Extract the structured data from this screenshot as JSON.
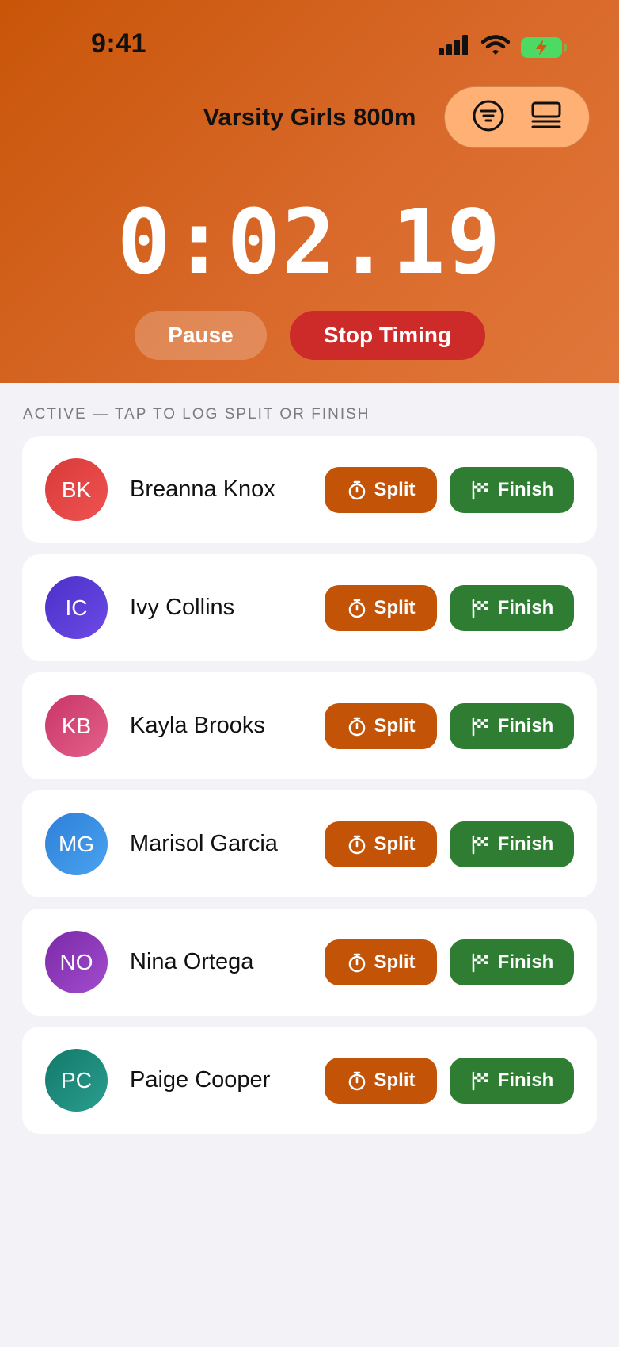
{
  "status_bar": {
    "time": "9:41"
  },
  "header": {
    "race_title": "Varsity Girls 800m",
    "timer": "0:02.19",
    "pause_label": "Pause",
    "stop_label": "Stop Timing"
  },
  "section": {
    "label": "ACTIVE — TAP TO LOG SPLIT OR FINISH"
  },
  "buttons": {
    "split_label": "Split",
    "finish_label": "Finish"
  },
  "athletes": [
    {
      "initials": "BK",
      "name": "Breanna Knox",
      "color_from": "#d83a3a",
      "color_to": "#ef5350"
    },
    {
      "initials": "IC",
      "name": "Ivy Collins",
      "color_from": "#4a30c8",
      "color_to": "#6d4ae6"
    },
    {
      "initials": "KB",
      "name": "Kayla Brooks",
      "color_from": "#c93567",
      "color_to": "#e2618a"
    },
    {
      "initials": "MG",
      "name": "Marisol Garcia",
      "color_from": "#2d7fd8",
      "color_to": "#4aa3ef"
    },
    {
      "initials": "NO",
      "name": "Nina Ortega",
      "color_from": "#7b2aa8",
      "color_to": "#a14ccd"
    },
    {
      "initials": "PC",
      "name": "Paige Cooper",
      "color_from": "#127a6a",
      "color_to": "#2a9d8f"
    }
  ],
  "colors": {
    "header_gradient_start": "#c85508",
    "header_gradient_end": "#e0773a",
    "split_button": "#c35306",
    "finish_button": "#2e7d32",
    "stop_button": "#cd2a2a",
    "nav_pill": "#ffb074",
    "page_background": "#f2f2f7"
  },
  "icons": {
    "status": [
      "cellular-signal-icon",
      "wifi-icon",
      "battery-charging-icon"
    ],
    "nav": [
      "filter-icon",
      "list-view-icon"
    ],
    "split": "stopwatch-icon",
    "finish": "checkered-flag-icon"
  }
}
